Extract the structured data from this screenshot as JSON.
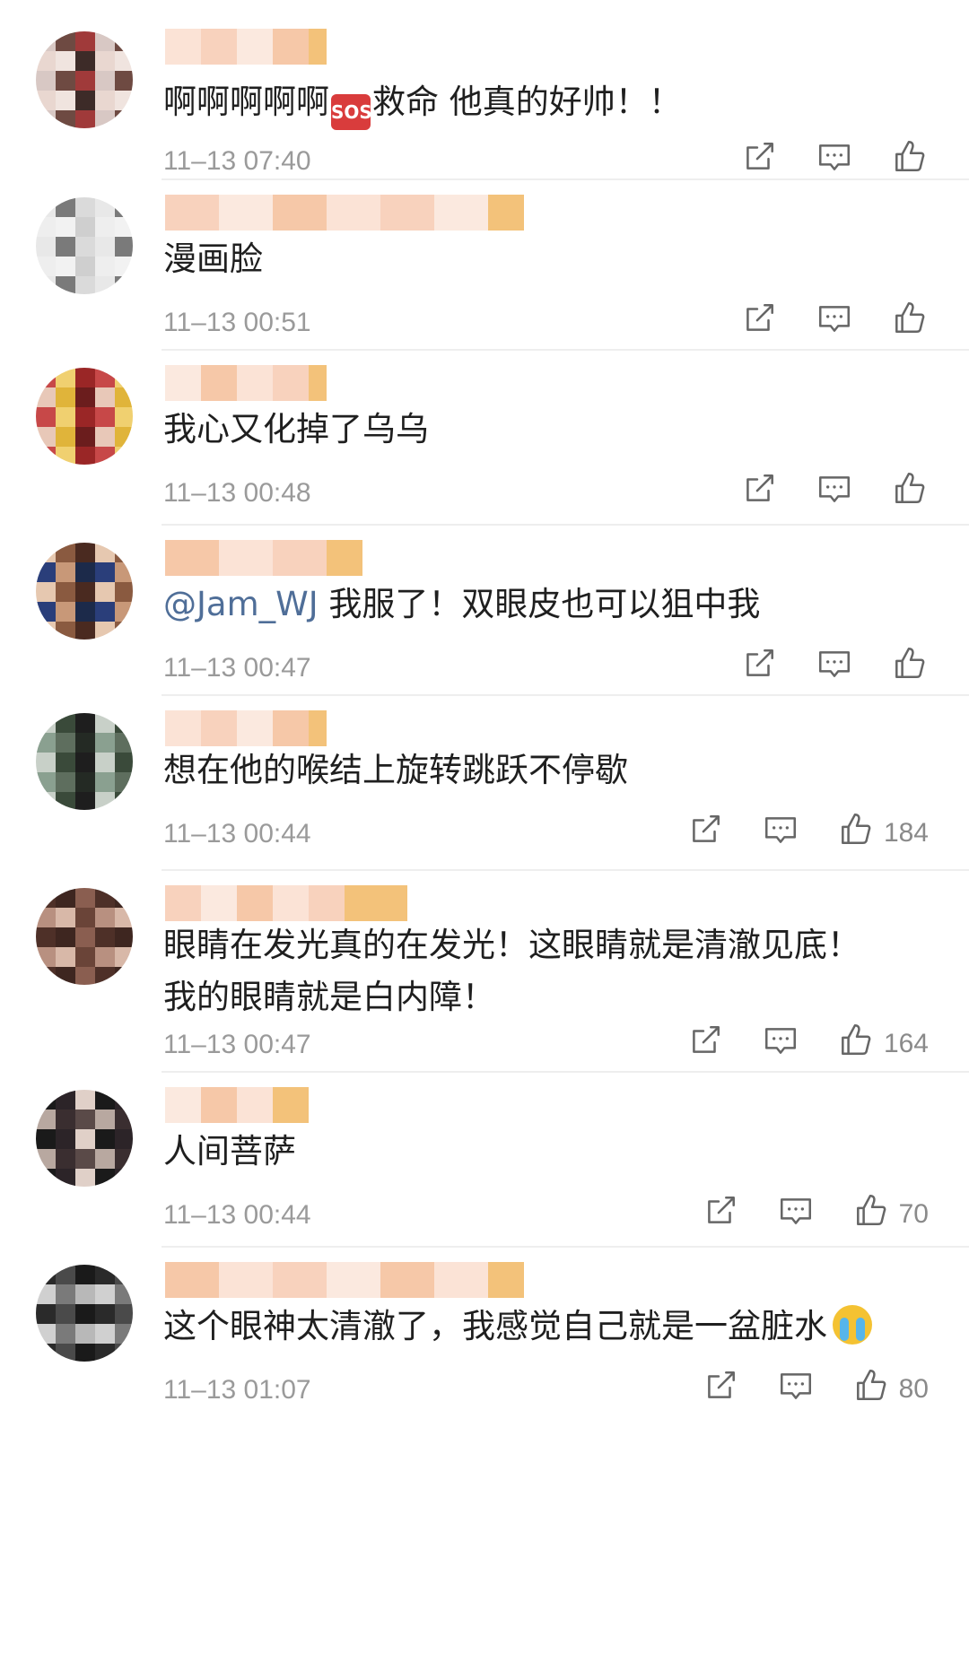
{
  "colors": {
    "mention": "#4f6e98",
    "timestamp": "#9a9a9a",
    "divider": "#eeeeee",
    "icon": "#666666"
  },
  "comments": [
    {
      "segments": [
        {
          "type": "text",
          "value": "啊啊啊啊啊"
        },
        {
          "type": "emoji",
          "icon": "sos-emoji",
          "value": "SOS"
        },
        {
          "type": "text",
          "value": "救命 他真的好帅！！"
        }
      ],
      "time": "11–13 07:40",
      "likes": ""
    },
    {
      "segments": [
        {
          "type": "text",
          "value": "漫画脸"
        }
      ],
      "time": "11–13 00:51",
      "likes": ""
    },
    {
      "segments": [
        {
          "type": "text",
          "value": "我心又化掉了乌乌"
        }
      ],
      "time": "11–13 00:48",
      "likes": ""
    },
    {
      "segments": [
        {
          "type": "mention",
          "value": "@Jam_WJ"
        },
        {
          "type": "text",
          "value": " 我服了！双眼皮也可以狙中我"
        }
      ],
      "time": "11–13 00:47",
      "likes": ""
    },
    {
      "segments": [
        {
          "type": "text",
          "value": "想在他的喉结上旋转跳跃不停歇"
        }
      ],
      "time": "11–13 00:44",
      "likes": "184"
    },
    {
      "segments": [
        {
          "type": "text",
          "value": "眼睛在发光真的在发光！这眼睛就是清澈见底！"
        }
      ],
      "line2": "我的眼睛就是白内障！",
      "time": "11–13 00:47",
      "likes": "164"
    },
    {
      "segments": [
        {
          "type": "text",
          "value": "人间菩萨"
        }
      ],
      "time": "11–13 00:44",
      "likes": "70"
    },
    {
      "segments": [
        {
          "type": "text",
          "value": "这个眼神太清澈了，我感觉自己就是一盆脏水"
        },
        {
          "type": "emoji",
          "icon": "crying-face-emoji",
          "value": ""
        }
      ],
      "time": "11–13 01:07",
      "likes": "80"
    }
  ],
  "icons": {
    "repost": "repost-icon",
    "comment": "comment-icon",
    "like": "thumbs-up-icon"
  }
}
